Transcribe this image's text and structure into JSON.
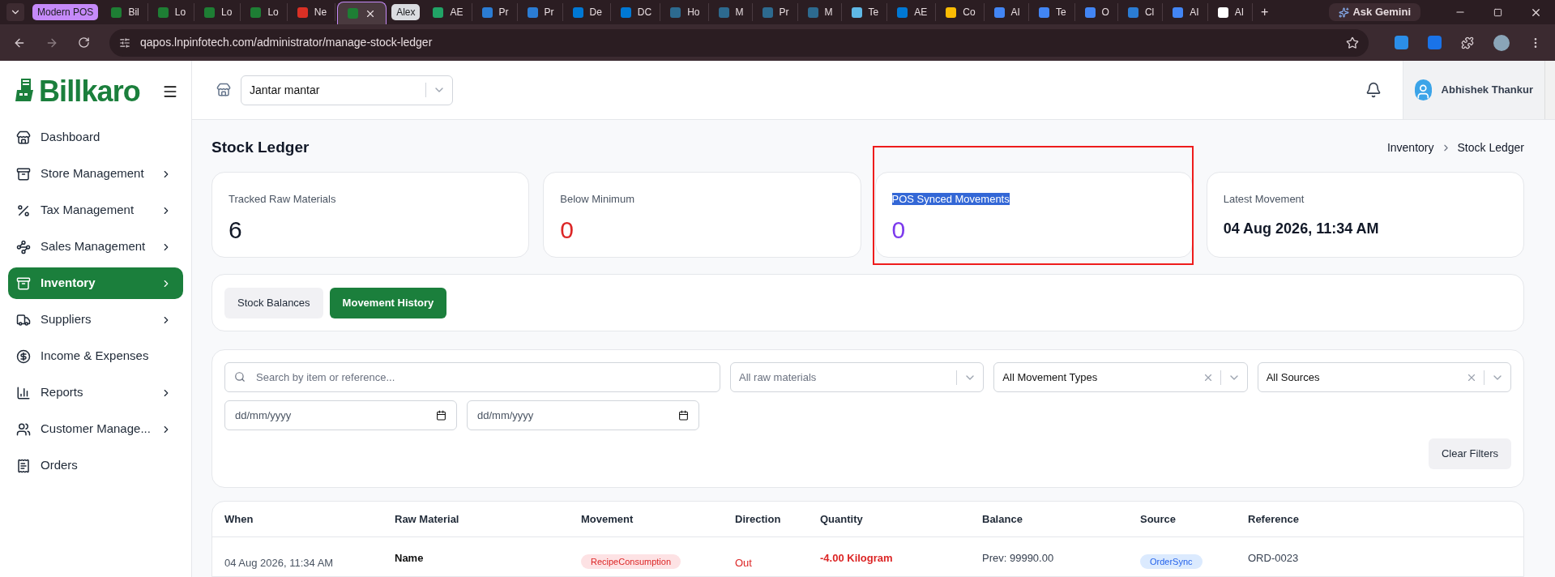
{
  "browser": {
    "tabs": [
      {
        "kind": "group",
        "label": "Modern POS",
        "color": "#c58af9"
      },
      {
        "kind": "tab",
        "label": "Bil",
        "color": "#1e7e34",
        "selected": false
      },
      {
        "kind": "tab",
        "label": "Lo",
        "color": "#1e7e34",
        "selected": false
      },
      {
        "kind": "tab",
        "label": "Lo",
        "color": "#1e7e34",
        "selected": false
      },
      {
        "kind": "tab",
        "label": "Lo",
        "color": "#1e7e34",
        "selected": false
      },
      {
        "kind": "tab",
        "label": "Ne",
        "color": "#d93025",
        "selected": false
      },
      {
        "kind": "tab",
        "color": "#1e7e34",
        "selected": true
      },
      {
        "kind": "group",
        "label": "Alex",
        "color": "#dadce0"
      },
      {
        "kind": "tab",
        "label": "AE",
        "color": "#21a366",
        "selected": false
      },
      {
        "kind": "tab",
        "label": "Pr",
        "color": "#2b7cd3",
        "selected": false
      },
      {
        "kind": "tab",
        "label": "Pr",
        "color": "#2b7cd3",
        "selected": false
      },
      {
        "kind": "tab",
        "label": "De",
        "color": "#0078d4",
        "selected": false
      },
      {
        "kind": "tab",
        "label": "DC",
        "color": "#0078d4",
        "selected": false
      },
      {
        "kind": "tab",
        "label": "Ho",
        "color": "#2d6a8f",
        "selected": false
      },
      {
        "kind": "tab",
        "label": "M",
        "color": "#2d6a8f",
        "selected": false
      },
      {
        "kind": "tab",
        "label": "Pr",
        "color": "#2d6a8f",
        "selected": false
      },
      {
        "kind": "tab",
        "label": "M",
        "color": "#2d6a8f",
        "selected": false
      },
      {
        "kind": "tab",
        "label": "Te",
        "color": "#5fb8e6",
        "selected": false
      },
      {
        "kind": "tab",
        "label": "AE",
        "color": "#0078d4",
        "selected": false
      },
      {
        "kind": "tab",
        "label": "Co",
        "color": "#fbbc04",
        "selected": false
      },
      {
        "kind": "tab",
        "label": "AI",
        "color": "#4285f4",
        "selected": false
      },
      {
        "kind": "tab",
        "label": "Te",
        "color": "#4285f4",
        "selected": false
      },
      {
        "kind": "tab",
        "label": "O",
        "color": "#4285f4",
        "selected": false
      },
      {
        "kind": "tab",
        "label": "Cl",
        "color": "#2b7cd3",
        "selected": false
      },
      {
        "kind": "tab",
        "label": "AI",
        "color": "#4285f4",
        "selected": false
      },
      {
        "kind": "tab",
        "label": "AI",
        "color": "#ffffff",
        "selected": false
      }
    ],
    "new_tab": "+",
    "gemini": "Ask Gemini",
    "url": "qapos.lnpinfotech.com/administrator/manage-stock-ledger"
  },
  "sidebar": {
    "logo": "Billkaro",
    "items": [
      {
        "label": "Dashboard",
        "submenu": false,
        "selected": false
      },
      {
        "label": "Store Management",
        "submenu": true,
        "selected": false
      },
      {
        "label": "Tax Management",
        "submenu": true,
        "selected": false
      },
      {
        "label": "Sales Management",
        "submenu": true,
        "selected": false
      },
      {
        "label": "Inventory",
        "submenu": true,
        "selected": true
      },
      {
        "label": "Suppliers",
        "submenu": true,
        "selected": false
      },
      {
        "label": "Income & Expenses",
        "submenu": false,
        "selected": false
      },
      {
        "label": "Reports",
        "submenu": true,
        "selected": false
      },
      {
        "label": "Customer Manage...",
        "submenu": true,
        "selected": false
      },
      {
        "label": "Orders",
        "submenu": false,
        "selected": false
      }
    ]
  },
  "header": {
    "store": "Jantar mantar",
    "user": "Abhishek Thankur"
  },
  "page": {
    "title": "Stock Ledger",
    "breadcrumb": [
      "Inventory",
      "Stock Ledger"
    ]
  },
  "stats": [
    {
      "label": "Tracked Raw Materials",
      "value": "6",
      "color": "#111827",
      "highlighted": false
    },
    {
      "label": "Below Minimum",
      "value": "0",
      "color": "#dc2626",
      "highlighted": false
    },
    {
      "label": "POS Synced Movements",
      "value": "0",
      "color": "#7c3aed",
      "highlighted": true
    },
    {
      "label": "Latest Movement",
      "value": "04 Aug 2026, 11:34 AM",
      "color": "#111827",
      "highlighted": false
    }
  ],
  "view_tabs": [
    {
      "label": "Stock Balances",
      "selected": false
    },
    {
      "label": "Movement History",
      "selected": true
    }
  ],
  "filters": {
    "search": {
      "placeholder": "Search by item or reference..."
    },
    "selects": [
      {
        "placeholder": "All raw materials",
        "clearable": false
      },
      {
        "value": "All Movement Types",
        "clearable": true
      },
      {
        "value": "All Sources",
        "clearable": true
      }
    ],
    "dates": [
      {
        "placeholder": "dd/mm/yyyy"
      },
      {
        "placeholder": "dd/mm/yyyy"
      }
    ],
    "clear": "Clear Filters"
  },
  "table": {
    "columns": [
      "When",
      "Raw Material",
      "Movement",
      "Direction",
      "Quantity",
      "Balance",
      "Source",
      "Reference"
    ],
    "rows": [
      {
        "when": "04 Aug 2026, 11:34 AM",
        "raw_material": "Name",
        "movement": "RecipeConsumption",
        "direction": "Out",
        "quantity": "-4.00 Kilogram",
        "balance": "Prev: 99990.00",
        "source": "OrderSync",
        "reference": "ORD-0023"
      }
    ]
  }
}
